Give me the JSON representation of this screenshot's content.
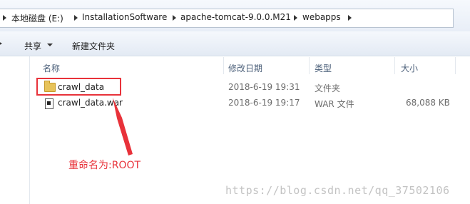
{
  "address_bar": {
    "crumbs": [
      "本地磁盘 (E:)",
      "InstallationSoftware",
      "apache-tomcat-9.0.0.M21",
      "webapps"
    ]
  },
  "toolbar": {
    "share_label": "共享",
    "new_folder_label": "新建文件夹"
  },
  "columns": {
    "name": "名称",
    "modified": "修改日期",
    "type": "类型",
    "size": "大小"
  },
  "files": [
    {
      "name": "crawl_data",
      "modified": "2018-6-19 19:31",
      "type": "文件夹",
      "size": "",
      "icon": "folder-icon"
    },
    {
      "name": "crawl_data.war",
      "modified": "2018-6-19 19:17",
      "type": "WAR 文件",
      "size": "68,088 KB",
      "icon": "file-icon"
    }
  ],
  "annotation": {
    "text": "重命名为:ROOT",
    "color": "#e8323a"
  },
  "watermark": "https://blog.csdn.net/qq_37502106"
}
